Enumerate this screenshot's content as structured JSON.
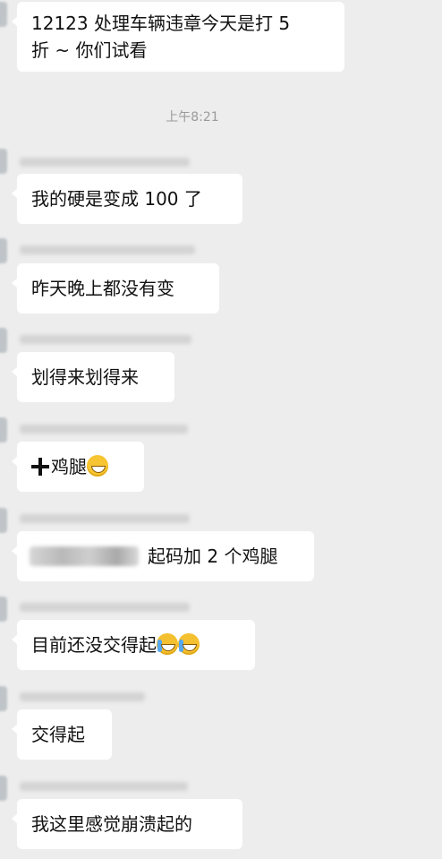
{
  "chat": {
    "timestamp": "上午8:21",
    "messages": [
      {
        "id": "m1",
        "text_line1": "12123 处理车辆违章今天是打 5",
        "text_line2": "折 ~ 你们试看"
      },
      {
        "id": "m2",
        "text": "我的硬是变成 100 了"
      },
      {
        "id": "m3",
        "text": "昨天晚上都没有变"
      },
      {
        "id": "m4",
        "text": "划得来划得来"
      },
      {
        "id": "m5",
        "text": "鸡腿",
        "icons": [
          "plus-icon",
          "grinning-emoji-icon"
        ]
      },
      {
        "id": "m6",
        "text": "起码加 2 个鸡腿",
        "mention_hidden": true
      },
      {
        "id": "m7",
        "text": "目前还没交得起",
        "icons": [
          "crying-emoji-icon",
          "crying-emoji-icon"
        ]
      },
      {
        "id": "m8",
        "text": "交得起"
      },
      {
        "id": "m9",
        "text": "我这里感觉崩溃起的"
      }
    ]
  },
  "colors": {
    "background": "#ededed",
    "bubble": "#ffffff",
    "text": "#111111",
    "timestamp": "#9a9a9a"
  }
}
